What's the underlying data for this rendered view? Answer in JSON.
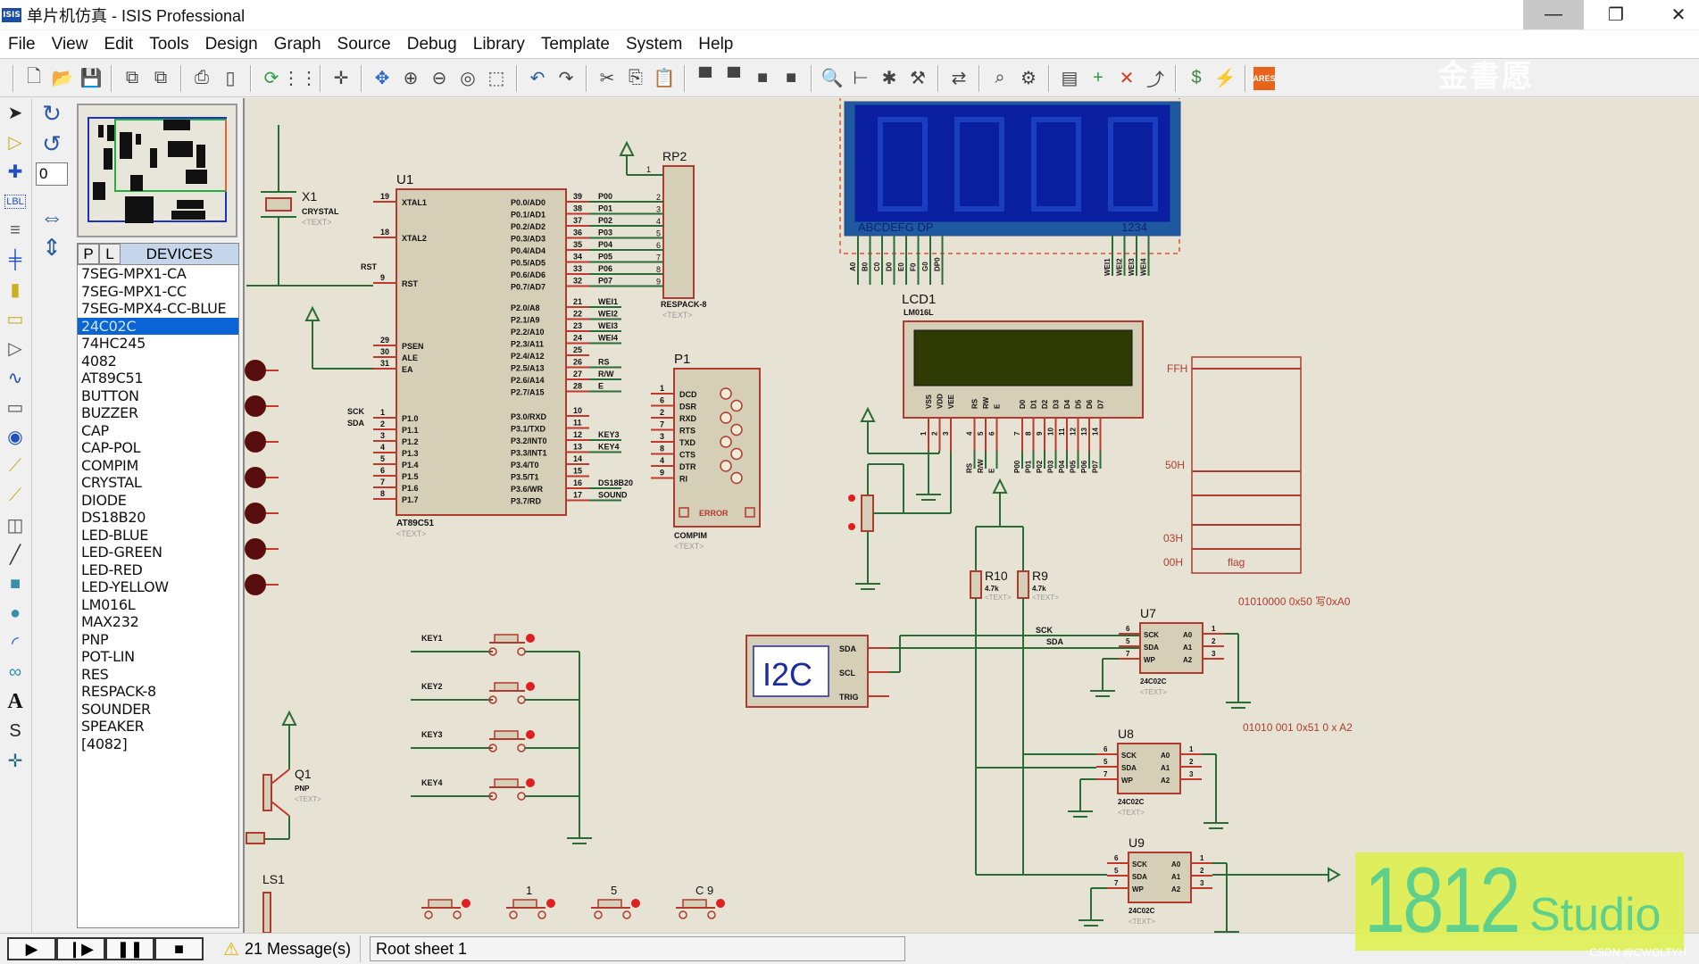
{
  "window": {
    "logo": "ISIS",
    "title": "单片机仿真 - ISIS Professional",
    "controls": {
      "minimize": "—",
      "maximize": "❐",
      "close": "✕"
    }
  },
  "menu": [
    "File",
    "View",
    "Edit",
    "Tools",
    "Design",
    "Graph",
    "Source",
    "Debug",
    "Library",
    "Template",
    "System",
    "Help"
  ],
  "toolbar": {
    "groups": [
      [
        "new-file",
        "open-file",
        "save-file"
      ],
      [
        "import-section",
        "export-section"
      ],
      [
        "print",
        "set-area"
      ],
      [
        "redraw",
        "grid"
      ],
      [
        "origin"
      ],
      [
        "pan",
        "zoom-in",
        "zoom-out",
        "zoom-all",
        "zoom-area"
      ],
      [
        "undo",
        "redo"
      ],
      [
        "cut",
        "copy",
        "paste"
      ],
      [
        "copy-block",
        "move-block",
        "rotate-block",
        "delete-block"
      ],
      [
        "pick-device",
        "make-device",
        "packaging-tool",
        "decompose"
      ],
      [
        "wire-autorouter"
      ],
      [
        "search-tag",
        "property-assignment"
      ],
      [
        "design-explorer",
        "new-sheet",
        "remove-sheet",
        "exit-parent"
      ],
      [
        "bill-of-materials",
        "electrical-rule-check"
      ],
      [
        "ares"
      ]
    ],
    "ares_label": "ARES",
    "watermark": "金書愿"
  },
  "left_tools": [
    "selection",
    "component",
    "junction-dot",
    "wire-label",
    "text-script",
    "bus",
    "subcircuit",
    "terminals",
    "device-pins",
    "graph",
    "tape-recorder",
    "generator",
    "voltage-probe",
    "current-probe",
    "virtual-instruments",
    "line",
    "box",
    "circle",
    "arc",
    "path",
    "text",
    "symbol",
    "marker"
  ],
  "rotation": {
    "value": "0"
  },
  "devices": {
    "tab_p": "P",
    "tab_l": "L",
    "title": "DEVICES",
    "selected_index": 3,
    "items": [
      "7SEG-MPX1-CA",
      "7SEG-MPX1-CC",
      "7SEG-MPX4-CC-BLUE",
      "24C02C",
      "74HC245",
      "4082",
      "AT89C51",
      "BUTTON",
      "BUZZER",
      "CAP",
      "CAP-POL",
      "COMPIM",
      "CRYSTAL",
      "DIODE",
      "DS18B20",
      "LED-BLUE",
      "LED-GREEN",
      "LED-RED",
      "LED-YELLOW",
      "LM016L",
      "MAX232",
      "PNP",
      "POT-LIN",
      "RES",
      "RESPACK-8",
      "SOUNDER",
      "SPEAKER",
      "[4082]"
    ]
  },
  "schematic": {
    "u1": {
      "ref": "U1",
      "part": "AT89C51",
      "text": "<TEXT>",
      "left_pins": [
        {
          "n": "19",
          "name": "XTAL1"
        },
        {
          "n": "18",
          "name": "XTAL2"
        },
        {
          "n": "9",
          "name": "RST"
        },
        {
          "n": "29",
          "name": "PSEN"
        },
        {
          "n": "30",
          "name": "ALE"
        },
        {
          "n": "31",
          "name": "EA"
        },
        {
          "n": "1",
          "name": "P1.0"
        },
        {
          "n": "2",
          "name": "P1.1"
        },
        {
          "n": "3",
          "name": "P1.2"
        },
        {
          "n": "4",
          "name": "P1.3"
        },
        {
          "n": "5",
          "name": "P1.4"
        },
        {
          "n": "6",
          "name": "P1.5"
        },
        {
          "n": "7",
          "name": "P1.6"
        },
        {
          "n": "8",
          "name": "P1.7"
        }
      ],
      "p0_pins": [
        {
          "n": "39",
          "name": "P0.0/AD0",
          "net": "P00",
          "rp": "2"
        },
        {
          "n": "38",
          "name": "P0.1/AD1",
          "net": "P01",
          "rp": "3"
        },
        {
          "n": "37",
          "name": "P0.2/AD2",
          "net": "P02",
          "rp": "4"
        },
        {
          "n": "36",
          "name": "P0.3/AD3",
          "net": "P03",
          "rp": "5"
        },
        {
          "n": "35",
          "name": "P0.4/AD4",
          "net": "P04",
          "rp": "6"
        },
        {
          "n": "34",
          "name": "P0.5/AD5",
          "net": "P05",
          "rp": "7"
        },
        {
          "n": "33",
          "name": "P0.6/AD6",
          "net": "P06",
          "rp": "8"
        },
        {
          "n": "32",
          "name": "P0.7/AD7",
          "net": "P07",
          "rp": "9"
        }
      ],
      "p2_pins": [
        {
          "n": "21",
          "name": "P2.0/A8",
          "net": "WEI1"
        },
        {
          "n": "22",
          "name": "P2.1/A9",
          "net": "WEI2"
        },
        {
          "n": "23",
          "name": "P2.2/A10",
          "net": "WEI3"
        },
        {
          "n": "24",
          "name": "P2.3/A11",
          "net": "WEI4"
        },
        {
          "n": "25",
          "name": "P2.4/A12",
          "net": ""
        },
        {
          "n": "26",
          "name": "P2.5/A13",
          "net": "RS"
        },
        {
          "n": "27",
          "name": "P2.6/A14",
          "net": "R/W"
        },
        {
          "n": "28",
          "name": "P2.7/A15",
          "net": "E"
        }
      ],
      "p3_pins": [
        {
          "n": "10",
          "name": "P3.0/RXD",
          "net": ""
        },
        {
          "n": "11",
          "name": "P3.1/TXD",
          "net": ""
        },
        {
          "n": "12",
          "name": "P3.2/INT0",
          "net": "KEY3"
        },
        {
          "n": "13",
          "name": "P3.3/INT1",
          "net": "KEY4"
        },
        {
          "n": "14",
          "name": "P3.4/T0",
          "net": ""
        },
        {
          "n": "15",
          "name": "P3.5/T1",
          "net": ""
        },
        {
          "n": "16",
          "name": "P3.6/WR",
          "net": "DS18B20"
        },
        {
          "n": "17",
          "name": "P3.7/RD",
          "net": "SOUND"
        }
      ],
      "p1_nets": [
        "SCK",
        "SDA"
      ],
      "rst_net": "RST"
    },
    "x1": {
      "ref": "X1",
      "part": "CRYSTAL",
      "text": "<TEXT>"
    },
    "rp2": {
      "ref": "RP2",
      "part": "RESPACK-8",
      "text": "<TEXT>",
      "pin1": "1"
    },
    "p1": {
      "ref": "P1",
      "part": "COMPIM",
      "text": "<TEXT>",
      "error": "ERROR",
      "pins": [
        {
          "n": "1",
          "name": "DCD"
        },
        {
          "n": "6",
          "name": "DSR"
        },
        {
          "n": "2",
          "name": "RXD"
        },
        {
          "n": "7",
          "name": "RTS"
        },
        {
          "n": "3",
          "name": "TXD"
        },
        {
          "n": "8",
          "name": "CTS"
        },
        {
          "n": "4",
          "name": "DTR"
        },
        {
          "n": "9",
          "name": "RI"
        }
      ]
    },
    "seg": {
      "segments": "ABCDEFG  DP",
      "digits": "1234",
      "seg_nets": [
        "A0",
        "B0",
        "C0",
        "D0",
        "E0",
        "F0",
        "G0",
        "DP0"
      ],
      "digit_nets": [
        "WEI1",
        "WEI2",
        "WEI3",
        "WEI4"
      ]
    },
    "lcd": {
      "ref": "LCD1",
      "part": "LM016L",
      "pins": [
        {
          "n": "1",
          "name": "VSS"
        },
        {
          "n": "2",
          "name": "VDD"
        },
        {
          "n": "3",
          "name": "VEE"
        },
        {
          "n": "4",
          "name": "RS"
        },
        {
          "n": "5",
          "name": "RW"
        },
        {
          "n": "6",
          "name": "E"
        },
        {
          "n": "7",
          "name": "D0"
        },
        {
          "n": "8",
          "name": "D1"
        },
        {
          "n": "9",
          "name": "D2"
        },
        {
          "n": "10",
          "name": "D3"
        },
        {
          "n": "11",
          "name": "D4"
        },
        {
          "n": "12",
          "name": "D5"
        },
        {
          "n": "13",
          "name": "D6"
        },
        {
          "n": "14",
          "name": "D7"
        }
      ],
      "nets": [
        "RS",
        "R/W",
        "E",
        "P00",
        "P01",
        "P02",
        "P03",
        "P04",
        "P05",
        "P06",
        "P07"
      ]
    },
    "memory_map": {
      "labels": [
        "FFH",
        "50H",
        "03H",
        "00H"
      ],
      "cell": "flag"
    },
    "r10": {
      "ref": "R10",
      "value": "4.7k",
      "text": "<TEXT>"
    },
    "r9": {
      "ref": "R9",
      "value": "4.7k",
      "text": "<TEXT>"
    },
    "i2c": {
      "label": "I2C",
      "pins": [
        "SDA",
        "SCL",
        "TRIG"
      ]
    },
    "bus_labels": {
      "sck": "SCK",
      "sda": "SDA"
    },
    "eeproms": [
      {
        "ref": "U7",
        "part": "24C02C",
        "text": "<TEXT>",
        "note": "01010000 0x50     写0xA0"
      },
      {
        "ref": "U8",
        "part": "24C02C",
        "text": "<TEXT>",
        "note": "01010 001  0x51    0 x A2"
      },
      {
        "ref": "U9",
        "part": "24C02C",
        "text": "<TEXT>",
        "note": ""
      }
    ],
    "eeprom_pins": {
      "left": [
        {
          "n": "6",
          "name": "SCK"
        },
        {
          "n": "5",
          "name": "SDA"
        },
        {
          "n": "7",
          "name": "WP"
        }
      ],
      "right": [
        {
          "n": "1",
          "name": "A0"
        },
        {
          "n": "2",
          "name": "A1"
        },
        {
          "n": "3",
          "name": "A2"
        }
      ]
    },
    "keys": [
      "KEY1",
      "KEY2",
      "KEY3",
      "KEY4"
    ],
    "q1": {
      "ref": "Q1",
      "part": "PNP",
      "text": "<TEXT>"
    },
    "ls1": {
      "ref": "LS1"
    },
    "bottom_buttons": [
      "",
      "1",
      "5",
      "C 9"
    ]
  },
  "status": {
    "sim_controls": [
      "play",
      "step",
      "pause",
      "stop"
    ],
    "messages": "21 Message(s)",
    "sheet": "Root sheet 1"
  },
  "watermark": {
    "big": "1812",
    "small": "Studio",
    "credit": "CSDN @CWQLTYH"
  }
}
